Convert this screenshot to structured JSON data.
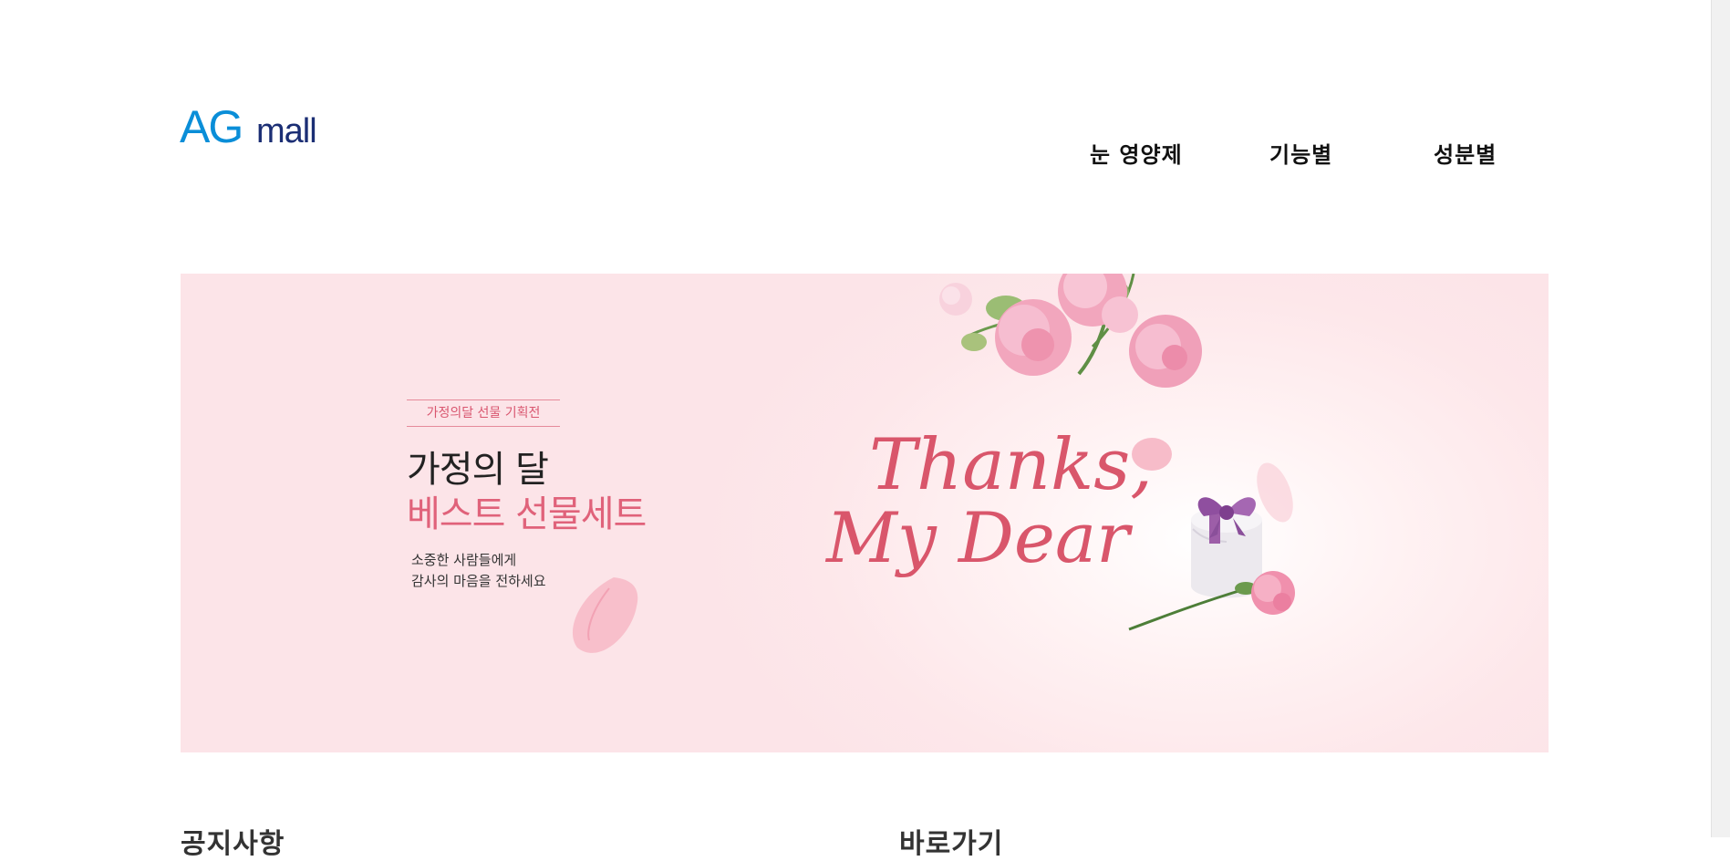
{
  "brand": {
    "logo_prefix": "AG",
    "logo_suffix": "mall",
    "logo_blue": "#0a8ed8",
    "logo_navy": "#1b2e74"
  },
  "nav": {
    "items": [
      {
        "label": "눈 영양제"
      },
      {
        "label": "기능별"
      },
      {
        "label": "성분별"
      }
    ]
  },
  "banner": {
    "tag": "가정의달 선물 기획전",
    "headline": "가정의 달",
    "subheadline": "베스트 선물세트",
    "description_lines": [
      "소중한 사람들에게",
      "감사의 마음을 전하세요"
    ],
    "script_line1": "Thanks,",
    "script_line2": "My Dear",
    "accent_color": "#e0627a",
    "background_color": "#fce4e8"
  },
  "sections": {
    "notice_title": "공지사항",
    "shortcut_title": "바로가기"
  }
}
